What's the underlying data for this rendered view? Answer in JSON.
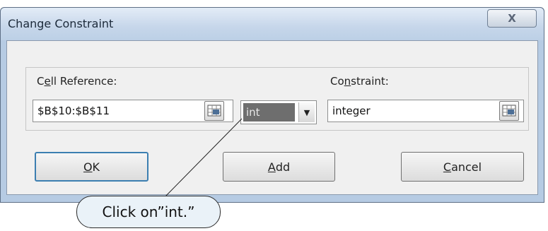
{
  "window": {
    "title": "Change Constraint",
    "close_glyph": "X"
  },
  "form": {
    "cell_reference_label_pre": "C",
    "cell_reference_label_accel": "e",
    "cell_reference_label_post": "ll Reference:",
    "cell_reference_value": "$B$10:$B$11",
    "operator_value": "int",
    "constraint_label_pre": "Co",
    "constraint_label_accel": "n",
    "constraint_label_post": "straint:",
    "constraint_value": "integer"
  },
  "buttons": {
    "ok_accel": "O",
    "ok_rest": "K",
    "add_accel": "A",
    "add_rest": "dd",
    "cancel_accel": "C",
    "cancel_rest": "ancel"
  },
  "annotation": {
    "callout_text": "Click on”int.”"
  },
  "icons": {
    "range_selector": "range-select-icon",
    "dropdown": "chevron-down-icon",
    "close": "close-icon"
  }
}
